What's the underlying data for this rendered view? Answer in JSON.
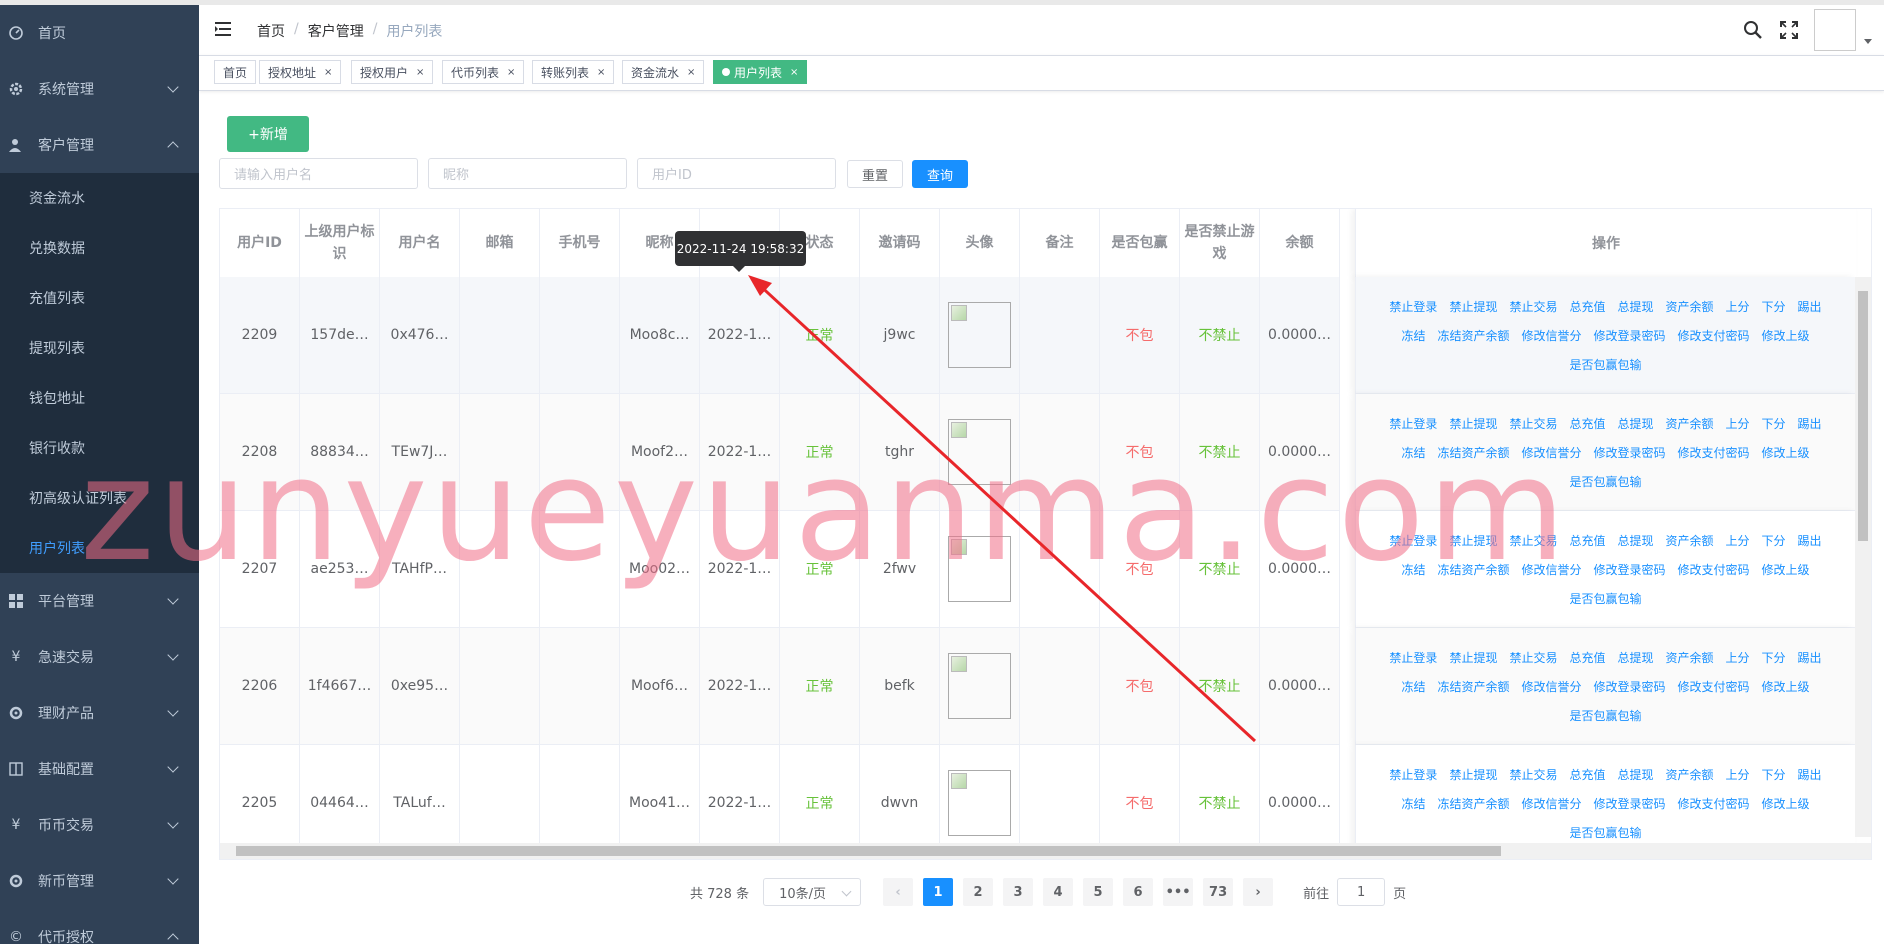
{
  "sidebar": {
    "items": [
      {
        "label": "首页",
        "icon": "dashboard-icon"
      },
      {
        "label": "系统管理",
        "icon": "gear-icon"
      },
      {
        "label": "客户管理",
        "icon": "user-icon"
      }
    ],
    "sub_items": [
      "资金流水",
      "兑换数据",
      "充值列表",
      "提现列表",
      "钱包地址",
      "银行收款",
      "初高级认证列表",
      "用户列表"
    ],
    "items_after": [
      {
        "label": "平台管理",
        "icon": "grid-icon"
      },
      {
        "label": "急速交易",
        "icon": "yen-icon"
      },
      {
        "label": "理财产品",
        "icon": "cycle-icon"
      },
      {
        "label": "基础配置",
        "icon": "book-icon"
      },
      {
        "label": "币币交易",
        "icon": "yen-icon"
      },
      {
        "label": "新币管理",
        "icon": "cycle-icon"
      },
      {
        "label": "代币授权",
        "icon": "copyright-icon"
      }
    ]
  },
  "breadcrumb": {
    "home": "首页",
    "section": "客户管理",
    "current": "用户列表"
  },
  "tags": [
    "首页",
    "授权地址",
    "授权用户",
    "代币列表",
    "转账列表",
    "资金流水",
    "用户列表"
  ],
  "toolbar": {
    "add_label": "+新增",
    "username_placeholder": "请输入用户名",
    "nickname_placeholder": "昵称",
    "userid_placeholder": "用户ID",
    "reset_label": "重置",
    "query_label": "查询"
  },
  "table": {
    "headers": [
      "用户ID",
      "上级用户标识",
      "用户名",
      "邮箱",
      "手机号",
      "昵称",
      "",
      "状态",
      "邀请码",
      "头像",
      "备注",
      "是否包赢",
      "是否禁止游戏",
      "余额"
    ],
    "ops_header": "操作",
    "rows": [
      {
        "id": "2209",
        "parent": "157de…",
        "username": "0x476…",
        "email": "",
        "phone": "",
        "nickname": "Moo8c…",
        "time": "2022-1…",
        "status": "正常",
        "invite": "j9wc",
        "note": "",
        "win": "不包",
        "game": "不禁止",
        "balance": "0.0000…"
      },
      {
        "id": "2208",
        "parent": "88834…",
        "username": "TEw7J…",
        "email": "",
        "phone": "",
        "nickname": "Moof2…",
        "time": "2022-1…",
        "status": "正常",
        "invite": "tghr",
        "note": "",
        "win": "不包",
        "game": "不禁止",
        "balance": "0.0000…"
      },
      {
        "id": "2207",
        "parent": "ae253…",
        "username": "TAHfP…",
        "email": "",
        "phone": "",
        "nickname": "Moo02…",
        "time": "2022-1…",
        "status": "正常",
        "invite": "2fwv",
        "note": "",
        "win": "不包",
        "game": "不禁止",
        "balance": "0.0000…"
      },
      {
        "id": "2206",
        "parent": "1f4667…",
        "username": "0xe95…",
        "email": "",
        "phone": "",
        "nickname": "Moof6…",
        "time": "2022-1…",
        "status": "正常",
        "invite": "befk",
        "note": "",
        "win": "不包",
        "game": "不禁止",
        "balance": "0.0000…"
      },
      {
        "id": "2205",
        "parent": "04464…",
        "username": "TALuf…",
        "email": "",
        "phone": "",
        "nickname": "Moo41…",
        "time": "2022-1…",
        "status": "正常",
        "invite": "dwvn",
        "note": "",
        "win": "不包",
        "game": "不禁止",
        "balance": "0.0000…"
      }
    ],
    "ops_line1": [
      "禁止登录",
      "禁止提现",
      "禁止交易",
      "总充值",
      "总提现",
      "资产余额",
      "上分",
      "下分",
      "踢出"
    ],
    "ops_line2": [
      "冻结",
      "冻结资产余额",
      "修改信誉分",
      "修改登录密码",
      "修改支付密码",
      "修改上级"
    ],
    "ops_line3": [
      "是否包赢包输"
    ]
  },
  "tooltip": "2022-11-24 19:58:32",
  "pagination": {
    "total": "共 728 条",
    "page_size": "10条/页",
    "pages": [
      "1",
      "2",
      "3",
      "4",
      "5",
      "6",
      "•••",
      "73"
    ],
    "current": "1",
    "goto_prefix": "前往",
    "goto_value": "1",
    "goto_suffix": "页"
  },
  "watermark": "zunyueyuanma.com",
  "colors": {
    "sidebar": "#304156",
    "submenu": "#1f2d3d",
    "accent": "#1890ff",
    "success": "#42b983",
    "danger": "#f56c6c",
    "ok": "#67c23a"
  }
}
